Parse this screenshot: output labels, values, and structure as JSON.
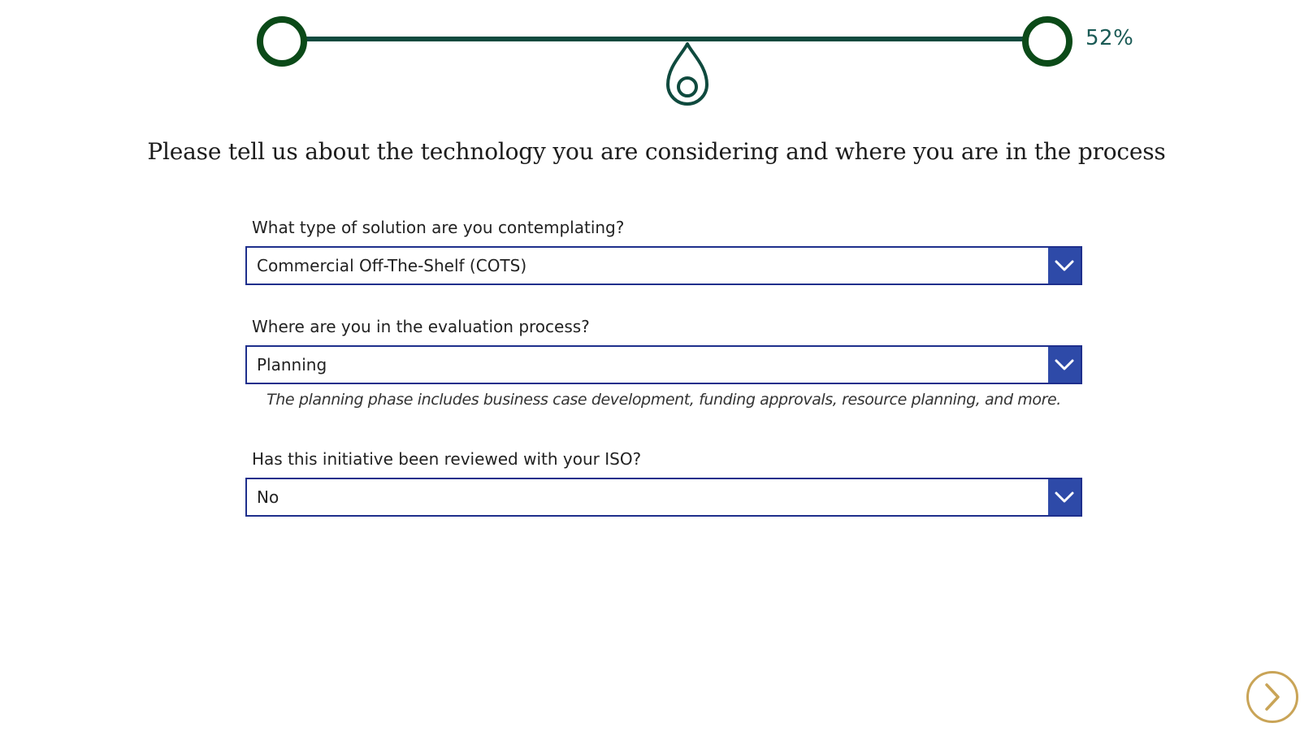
{
  "progress": {
    "percent_label": "52%",
    "value": 0.52,
    "start_node_icon": "circle-node-icon",
    "end_node_icon": "circle-node-icon",
    "marker_icon": "location-pin-icon"
  },
  "heading": "Please tell us about the technology you are considering and where you are in the process",
  "form": {
    "fields": [
      {
        "label": "What type of solution are you contemplating?",
        "value": "Commercial Off-The-Shelf (COTS)"
      },
      {
        "label": "Where are you in the evaluation process?",
        "value": "Planning",
        "hint": "The planning phase includes business case development, funding approvals, resource planning, and more."
      },
      {
        "label": "Has this initiative been reviewed with your ISO?",
        "value": "No"
      }
    ]
  },
  "navigation": {
    "next_icon": "chevron-right-icon"
  },
  "colors": {
    "track": "#0f4a3e",
    "node_ring": "#0b4a18",
    "percent_text": "#1a5a55",
    "select_border": "#1e2f8c",
    "select_arrow_bg": "#2e4aa8",
    "next_button": "#c9a457"
  }
}
